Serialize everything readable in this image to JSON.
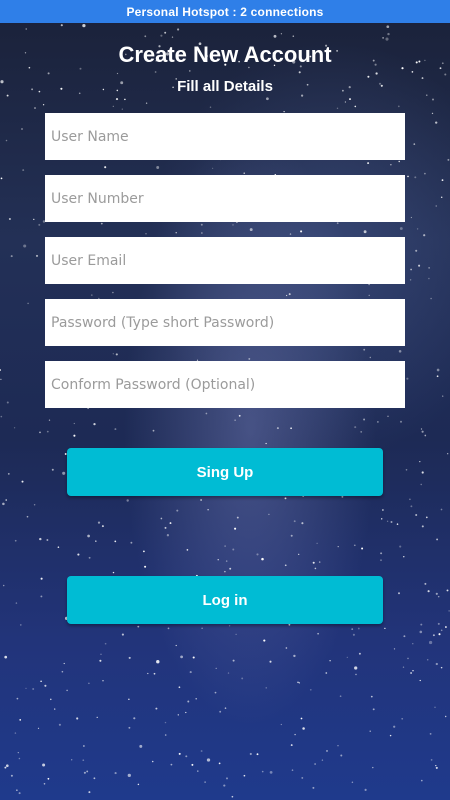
{
  "status_bar": {
    "text": "Personal Hotspot  :  2 connections",
    "color": "#2f7fe8"
  },
  "header": {
    "title": "Create New Account",
    "subtitle": "Fill all Details"
  },
  "form": {
    "fields": [
      {
        "placeholder": "User Name",
        "value": ""
      },
      {
        "placeholder": "User Number",
        "value": ""
      },
      {
        "placeholder": "User Email",
        "value": ""
      },
      {
        "placeholder": "Password (Type short Password)",
        "value": ""
      },
      {
        "placeholder": "Conform Password (Optional)",
        "value": ""
      }
    ]
  },
  "buttons": {
    "signup_label": "Sing Up",
    "login_label": "Log in",
    "accent_color": "#00bcd4"
  },
  "background": {
    "description_icon": "starry-night-sky"
  }
}
